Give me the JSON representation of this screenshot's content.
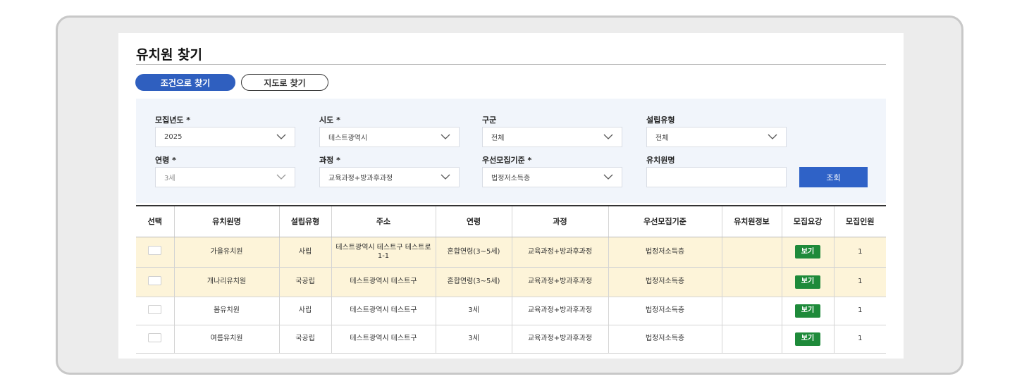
{
  "page": {
    "title": "유치원 찾기"
  },
  "tabs": [
    {
      "label": "조건으로 찾기",
      "active": true
    },
    {
      "label": "지도로 찾기",
      "active": false
    }
  ],
  "filters": {
    "year": {
      "label": "모집년도 *",
      "value": "2025"
    },
    "sido": {
      "label": "시도 *",
      "value": "테스트광역시"
    },
    "gugun": {
      "label": "구군",
      "value": "전체"
    },
    "type": {
      "label": "설립유형",
      "value": "전체"
    },
    "age": {
      "label": "연령 *",
      "value": "3세"
    },
    "course": {
      "label": "과정 *",
      "value": "교육과정+방과후과정"
    },
    "priority": {
      "label": "우선모집기준 *",
      "value": "법정저소득층"
    },
    "name": {
      "label": "유치원명",
      "value": ""
    },
    "search_label": "조회"
  },
  "table": {
    "headers": [
      "선택",
      "유치원명",
      "설립유형",
      "주소",
      "연령",
      "과정",
      "우선모집기준",
      "유치원정보",
      "모집요강",
      "모집인원"
    ],
    "rows": [
      {
        "name": "가을유치원",
        "type": "사립",
        "address": "테스트광역시 테스트구 테스트로 1-1",
        "age": "혼합연령(3~5세)",
        "course": "교육과정+방과후과정",
        "priority": "법정저소득층",
        "info": "",
        "guide": "보기",
        "count": "1"
      },
      {
        "name": "개나리유치원",
        "type": "국공립",
        "address": "테스트광역시 테스트구",
        "age": "혼합연령(3~5세)",
        "course": "교육과정+방과후과정",
        "priority": "법정저소득층",
        "info": "",
        "guide": "보기",
        "count": "1"
      },
      {
        "name": "봄유치원",
        "type": "사립",
        "address": "테스트광역시 테스트구",
        "age": "3세",
        "course": "교육과정+방과후과정",
        "priority": "법정저소득층",
        "info": "",
        "guide": "보기",
        "count": "1"
      },
      {
        "name": "여름유치원",
        "type": "국공립",
        "address": "테스트광역시 테스트구",
        "age": "3세",
        "course": "교육과정+방과후과정",
        "priority": "법정저소득층",
        "info": "",
        "guide": "보기",
        "count": "1"
      }
    ]
  },
  "colors": {
    "accent": "#2f5fbf",
    "view_button": "#1e8a3a",
    "highlight_row": "#fdf4d9",
    "filter_bg": "#f1f5fb"
  }
}
